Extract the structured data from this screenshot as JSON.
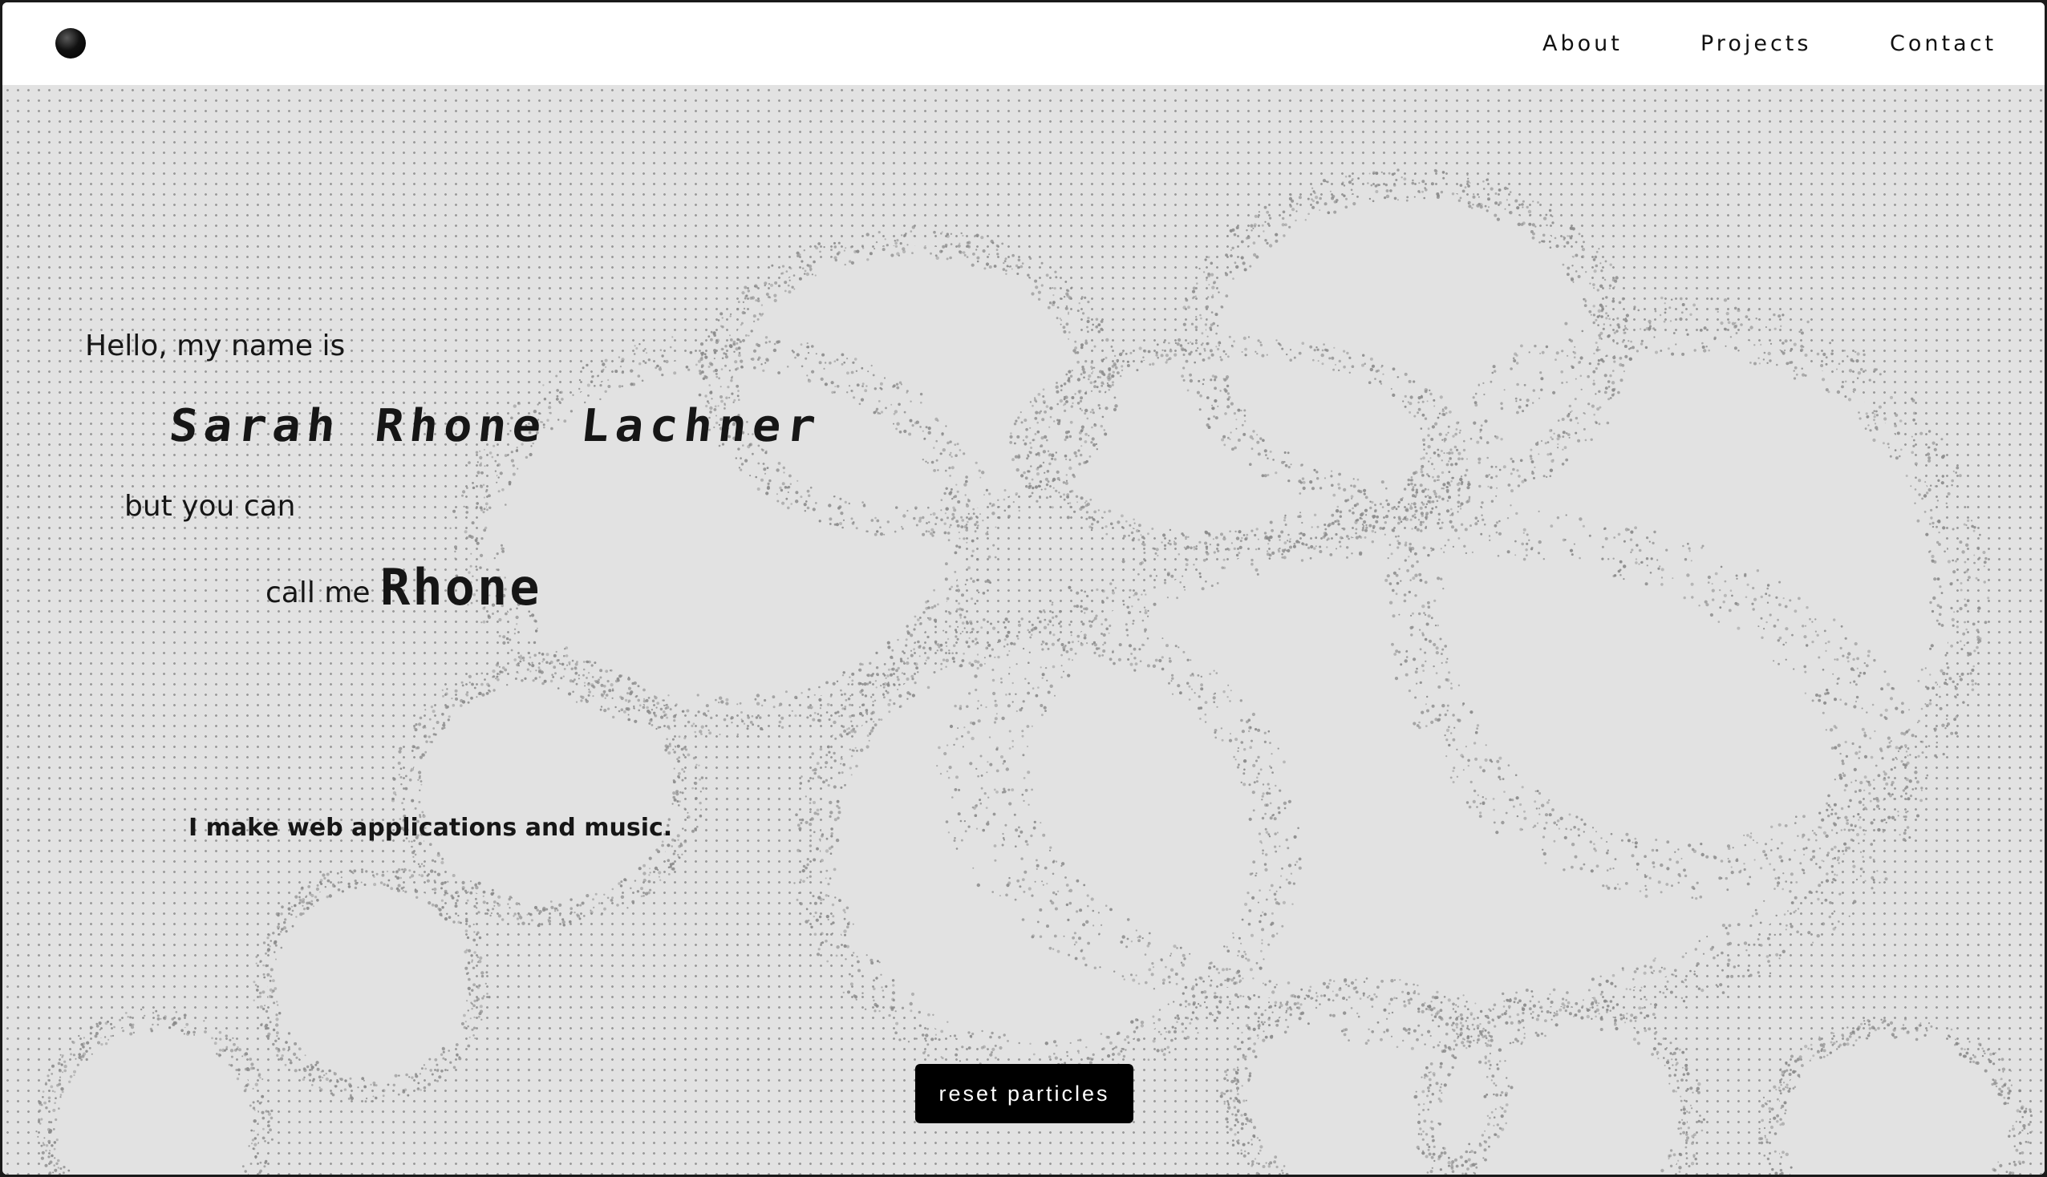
{
  "nav": {
    "links": [
      {
        "label": "About"
      },
      {
        "label": "Projects"
      },
      {
        "label": "Contact"
      }
    ]
  },
  "hero": {
    "greeting": "Hello, my name is",
    "full_name": "Sarah Rhone Lachner",
    "transition": "but you can",
    "call_prefix": "call me",
    "nickname": "Rhone",
    "tagline": "I make web applications and music."
  },
  "actions": {
    "reset_label": "reset particles"
  },
  "colors": {
    "background": "#e2e2e2",
    "dot": "#9a9a9a",
    "navbar": "#ffffff",
    "text": "#161616",
    "button_bg": "#000000",
    "button_text": "#ffffff"
  }
}
